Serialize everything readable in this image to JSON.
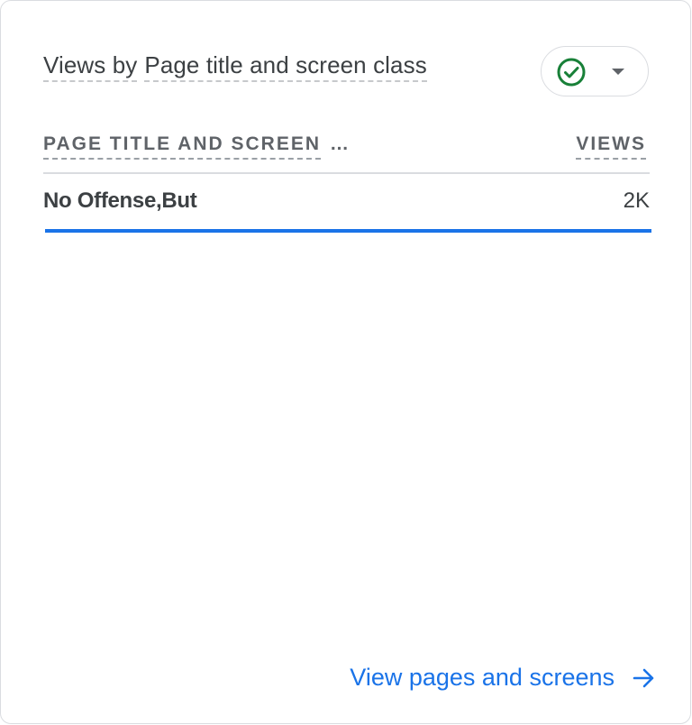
{
  "card": {
    "title_part1": "Views by",
    "title_part2": "Page title and screen class",
    "status_icon": "check-circle-icon",
    "status_color": "#188038",
    "dropdown_icon": "caret-down-icon"
  },
  "table": {
    "dimension_header": "PAGE TITLE AND SCREEN",
    "dimension_header_ellipsis": "…",
    "metric_header": "VIEWS",
    "rows": [
      {
        "name": "No Offense,But",
        "value": "2K",
        "share": 1.0
      }
    ],
    "bar_color": "#1a73e8"
  },
  "footer": {
    "link_label": "View pages and screens",
    "link_icon": "arrow-right-icon"
  }
}
